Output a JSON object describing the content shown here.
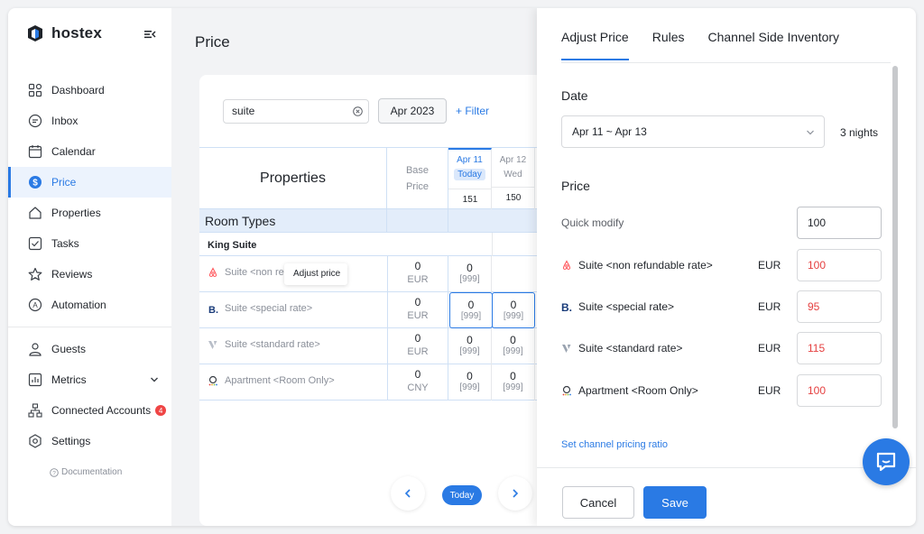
{
  "app": {
    "brand": "hostex"
  },
  "sidebar": {
    "items": [
      {
        "label": "Dashboard",
        "icon": "dashboard-icon"
      },
      {
        "label": "Inbox",
        "icon": "inbox-icon"
      },
      {
        "label": "Calendar",
        "icon": "calendar-icon"
      },
      {
        "label": "Price",
        "icon": "dollar-icon",
        "active": true
      },
      {
        "label": "Properties",
        "icon": "home-icon"
      },
      {
        "label": "Tasks",
        "icon": "checkbox-icon"
      },
      {
        "label": "Reviews",
        "icon": "star-icon"
      },
      {
        "label": "Automation",
        "icon": "automation-icon"
      }
    ],
    "items2": [
      {
        "label": "Guests",
        "icon": "user-icon"
      },
      {
        "label": "Metrics",
        "icon": "chart-icon"
      },
      {
        "label": "Connected Accounts",
        "icon": "network-icon",
        "badge": "4"
      },
      {
        "label": "Settings",
        "icon": "settings-icon"
      }
    ],
    "documentation": "Documentation"
  },
  "main": {
    "title": "Price",
    "search_value": "suite",
    "month": "Apr 2023",
    "filter": "+ Filter",
    "table": {
      "properties_header": "Properties",
      "base_header_1": "Base",
      "base_header_2": "Price",
      "days": [
        {
          "date": "Apr 11",
          "sub": "Today",
          "count": "151"
        },
        {
          "date": "Apr 12",
          "sub": "Wed",
          "count": "150"
        }
      ],
      "room_types": "Room Types",
      "group": "King Suite",
      "rows": [
        {
          "name": "Suite <non refundable rate>",
          "channel": "airbnb",
          "base": "0",
          "currency": "EUR",
          "cells": []
        },
        {
          "name": "Suite <special rate>",
          "channel": "booking",
          "base": "0",
          "currency": "EUR",
          "cells": [
            {
              "n": "0",
              "i": "[999]"
            },
            {
              "n": "0",
              "i": "[999]"
            }
          ]
        },
        {
          "name": "Suite <standard rate>",
          "channel": "vrbo",
          "base": "0",
          "currency": "EUR",
          "cells": [
            {
              "n": "0",
              "i": "[999]"
            },
            {
              "n": "0",
              "i": "[999]"
            }
          ]
        },
        {
          "name": "Apartment <Room Only>",
          "channel": "agoda",
          "base": "0",
          "currency": "CNY",
          "cells": [
            {
              "n": "0",
              "i": "[999]"
            },
            {
              "n": "0",
              "i": "[999]"
            }
          ]
        }
      ],
      "row0_cell": {
        "n": "0",
        "i": "[999]"
      }
    },
    "tooltip": "Adjust price",
    "today_btn": "Today"
  },
  "panel": {
    "tabs": [
      "Adjust Price",
      "Rules",
      "Channel Side Inventory"
    ],
    "date_title": "Date",
    "date_range": "Apr 11 ~ Apr 13",
    "nights": "3 nights",
    "price_title": "Price",
    "quick_modify_label": "Quick modify",
    "quick_modify_value": "100",
    "rates": [
      {
        "name": "Suite <non refundable rate>",
        "currency": "EUR",
        "value": "100",
        "channel": "airbnb"
      },
      {
        "name": "Suite <special rate>",
        "currency": "EUR",
        "value": "95",
        "channel": "booking"
      },
      {
        "name": "Suite <standard rate>",
        "currency": "EUR",
        "value": "115",
        "channel": "vrbo"
      },
      {
        "name": "Apartment <Room Only>",
        "currency": "EUR",
        "value": "100",
        "channel": "agoda"
      }
    ],
    "ratio_link": "Set channel pricing ratio",
    "cancel": "Cancel",
    "save": "Save"
  },
  "colors": {
    "accent": "#2a7ae4",
    "danger": "#e54040"
  }
}
